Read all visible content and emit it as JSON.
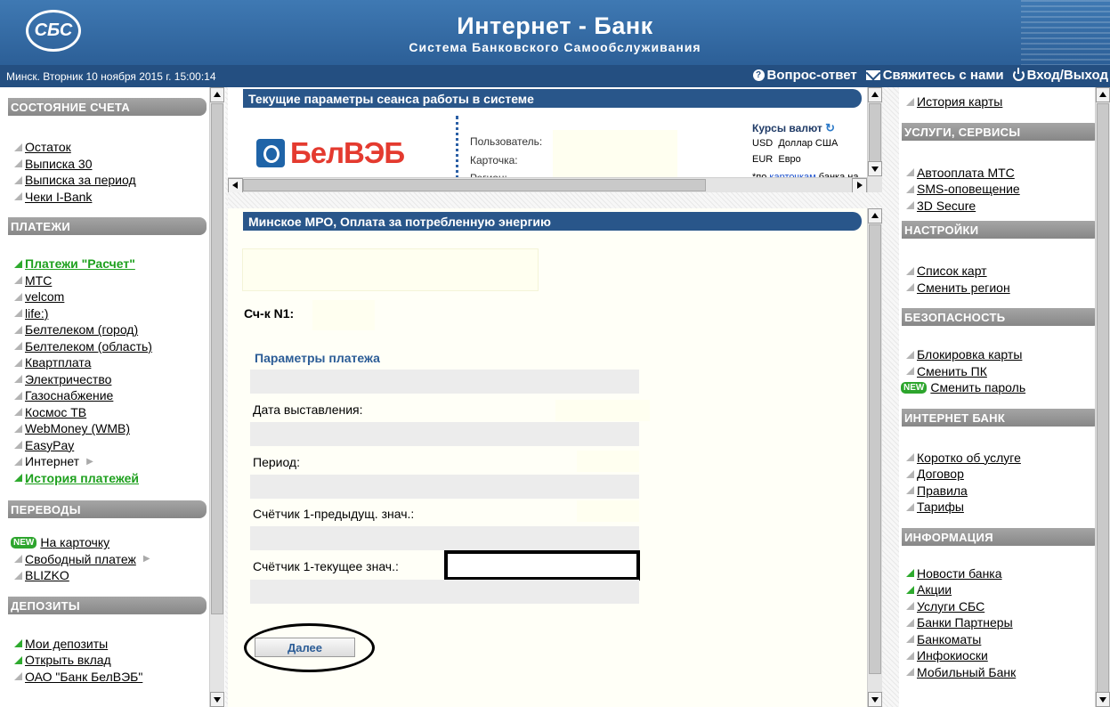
{
  "header": {
    "logo_text": "СБС",
    "title": "Интернет - Банк",
    "subtitle": "Система Банковского Самообслуживания"
  },
  "infobar": {
    "datetime": "Минск. Вторник 10 ноября 2015 г. 15:00:14",
    "links": [
      {
        "label": "Вопрос-ответ",
        "icon": "question-icon"
      },
      {
        "label": "Свяжитесь с нами",
        "icon": "mail-icon"
      },
      {
        "label": "Вход/Выход",
        "icon": "power-icon"
      }
    ]
  },
  "left_sidebar": {
    "sections": [
      {
        "title": "СОСТОЯНИЕ СЧЕТА",
        "items": [
          "Остаток",
          "Выписка 30",
          "Выписка за период",
          "Чеки I-Bank"
        ]
      },
      {
        "title": "ПЛАТЕЖИ",
        "items": [
          "Платежи \"Расчет\"",
          "МТС",
          "velcom",
          "life:)",
          "Белтелеком (город)",
          "Белтелеком (область)",
          "Квартплата",
          "Электричество",
          "Газоснабжение",
          "Космос ТВ",
          "WebMoney (WMB)",
          "EasyPay",
          "Интернет",
          "История платежей"
        ]
      },
      {
        "title": "ПЕРЕВОДЫ",
        "items": [
          "На карточку",
          "Свободный платеж",
          "BLIZKO"
        ]
      },
      {
        "title": "ДЕПОЗИТЫ",
        "items": [
          "Мои депозиты",
          "Открыть вклад",
          "ОАО \"Банк БелВЭБ\""
        ]
      }
    ]
  },
  "session": {
    "header": "Текущие параметры сеанса работы в системе",
    "bank_logo": "БелВЭБ",
    "labels": {
      "user": "Пользователь:",
      "card": "Карточка:",
      "region": "Регион:"
    },
    "rates_title": "Курсы валют",
    "rates": [
      {
        "code": "USD",
        "name": "Доллар США"
      },
      {
        "code": "EUR",
        "name": "Евро"
      }
    ],
    "rates_note_prefix": "*по ",
    "rates_note_link": "карточкам",
    "rates_note_suffix": " банка на"
  },
  "payment": {
    "header": "Минское МРО, Оплата за потребленную энергию",
    "counter_label": "Сч-к N1:",
    "params_title": "Параметры платежа",
    "fields": [
      {
        "label": "Дата выставления:"
      },
      {
        "label": "Период:"
      },
      {
        "label": "Счётчик 1-предыдущ. знач.:"
      },
      {
        "label": "Счётчик 1-текущее знач.:",
        "value": ""
      }
    ],
    "next_button": "Далее"
  },
  "right_sidebar": {
    "top_item": "История карты",
    "sections": [
      {
        "title": "УСЛУГИ, СЕРВИСЫ",
        "items": [
          "Автооплата МТС",
          "SMS-оповещение",
          "3D Secure"
        ]
      },
      {
        "title": "НАСТРОЙКИ",
        "items": [
          "Список карт",
          "Сменить регион"
        ]
      },
      {
        "title": "БЕЗОПАСНОСТЬ",
        "items": [
          "Блокировка карты",
          "Сменить ПК",
          "Сменить пароль"
        ]
      },
      {
        "title": "ИНТЕРНЕТ БАНК",
        "items": [
          "Коротко об услуге",
          "Договор",
          "Правила",
          "Тарифы"
        ]
      },
      {
        "title": "ИНФОРМАЦИЯ",
        "items": [
          "Новости банка",
          "Акции",
          "Услуги СБС",
          "Банки Партнеры",
          "Банкоматы",
          "Инфокиоски",
          "Мобильный Банк"
        ]
      }
    ]
  },
  "badges": {
    "new": "NEW"
  },
  "colors": {
    "header_blue": "#2c5f97",
    "infobar_blue": "#244f81",
    "green_link": "#1ea01e",
    "frame_head": "#29568a"
  }
}
